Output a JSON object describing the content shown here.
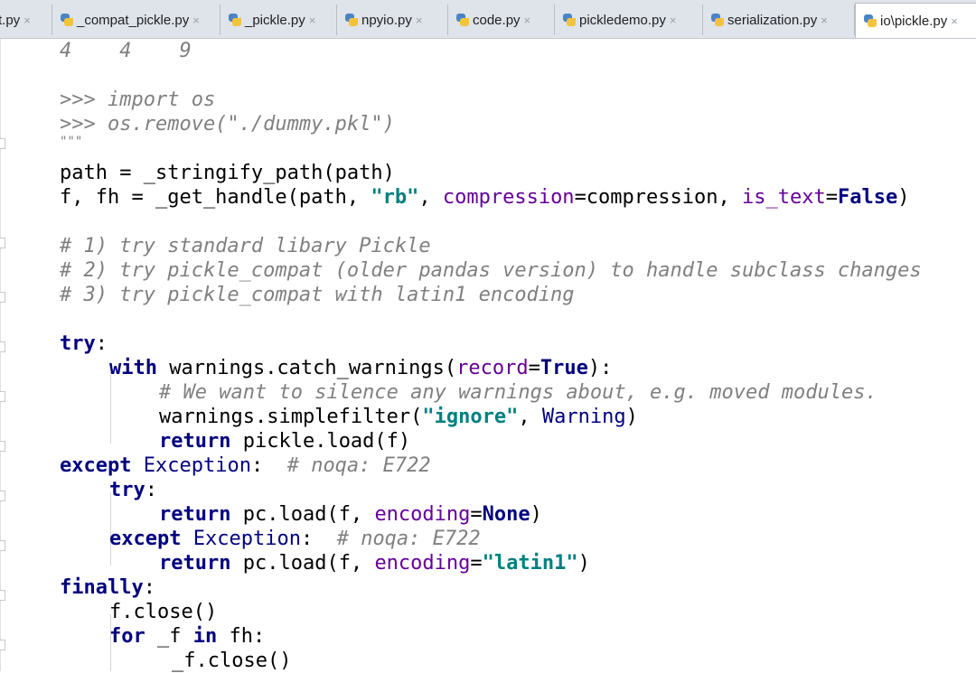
{
  "tabs": [
    {
      "label": "t.py",
      "active": false
    },
    {
      "label": "_compat_pickle.py",
      "active": false
    },
    {
      "label": "_pickle.py",
      "active": false
    },
    {
      "label": "npyio.py",
      "active": false
    },
    {
      "label": "code.py",
      "active": false
    },
    {
      "label": "pickledemo.py",
      "active": false
    },
    {
      "label": "serialization.py",
      "active": false
    },
    {
      "label": "io\\pickle.py",
      "active": true
    }
  ],
  "close_glyph": "×",
  "colors": {
    "keyword": "#000080",
    "comment": "#808080",
    "string": "#008080",
    "param": "#660099",
    "tabbar": "#dfe3ea"
  },
  "code": {
    "l01": "4    4    9",
    "l03a": ">>> import os",
    "l04a": ">>> os.remove(\"./dummy.pkl\")",
    "l05a": "\"\"\"",
    "l06": "path = _stringify_path(path)",
    "l07_1": "f, fh = _get_handle(path, ",
    "l07_2": "\"rb\"",
    "l07_3": ", ",
    "l07_4": "compression",
    "l07_5": "=compression, ",
    "l07_6": "is_text",
    "l07_7": "=",
    "l07_8": "False",
    "l07_9": ")",
    "l09": "# 1) try standard libary Pickle",
    "l10": "# 2) try pickle_compat (older pandas version) to handle subclass changes",
    "l11": "# 3) try pickle_compat with latin1 encoding",
    "l13_kw": "try",
    "l13_r": ":",
    "l14_kw": "with",
    "l14_1": " warnings.catch_warnings(",
    "l14_2": "record",
    "l14_3": "=",
    "l14_4": "True",
    "l14_5": "):",
    "l15": "# We want to silence any warnings about, e.g. moved modules.",
    "l16_1": "warnings.simplefilter(",
    "l16_2": "\"ignore\"",
    "l16_3": ", ",
    "l16_4": "Warning",
    "l16_5": ")",
    "l17_kw": "return",
    "l17_r": " pickle.load(f)",
    "l18_kw": "except",
    "l18_1": " ",
    "l18_2": "Exception",
    "l18_3": ":  ",
    "l18_4": "# noqa: E722",
    "l19_kw": "try",
    "l19_r": ":",
    "l20_kw": "return",
    "l20_1": " pc.load(f, ",
    "l20_2": "encoding",
    "l20_3": "=",
    "l20_4": "None",
    "l20_5": ")",
    "l21_kw": "except",
    "l21_1": " ",
    "l21_2": "Exception",
    "l21_3": ":  ",
    "l21_4": "# noqa: E722",
    "l22_kw": "return",
    "l22_1": " pc.load(f, ",
    "l22_2": "encoding",
    "l22_3": "=",
    "l22_4": "\"latin1\"",
    "l22_5": ")",
    "l23_kw": "finally",
    "l23_r": ":",
    "l24": "f.close()",
    "l25_kw1": "for",
    "l25_1": " _f ",
    "l25_kw2": "in",
    "l25_2": " fh:",
    "l26": "_f.close()"
  }
}
